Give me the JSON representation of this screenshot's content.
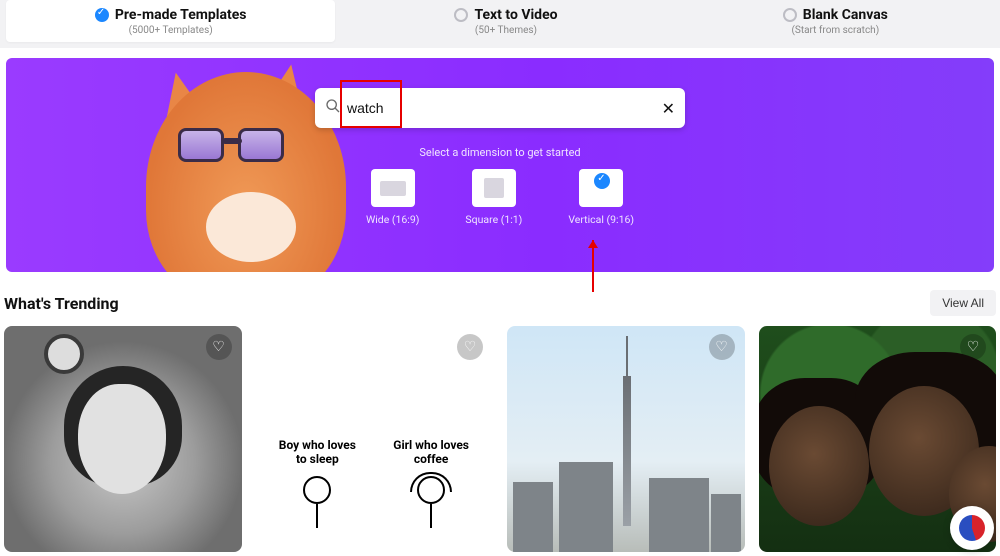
{
  "colors": {
    "accent": "#1b87ff",
    "hero_bg": "#8a2cff",
    "annotation": "#e60000"
  },
  "modes": {
    "premade": {
      "label": "Pre-made Templates",
      "sub": "(5000+ Templates)",
      "selected": true
    },
    "text_to_video": {
      "label": "Text to Video",
      "sub": "(50+ Themes)",
      "selected": false
    },
    "blank": {
      "label": "Blank Canvas",
      "sub": "(Start from scratch)",
      "selected": false
    }
  },
  "hero": {
    "search_value": "watch",
    "search_placeholder": "",
    "hint": "Select a dimension to get started",
    "dimensions": {
      "wide": {
        "label": "Wide (16:9)",
        "selected": false
      },
      "square": {
        "label": "Square (1:1)",
        "selected": false
      },
      "vertical": {
        "label": "Vertical (9:16)",
        "selected": true
      }
    }
  },
  "trending": {
    "title": "What's Trending",
    "view_all": "View All",
    "cards": {
      "card2": {
        "col1_line1": "Boy who loves",
        "col1_line2": "to sleep",
        "col2_line1": "Girl who loves",
        "col2_line2": "coffee"
      }
    }
  }
}
